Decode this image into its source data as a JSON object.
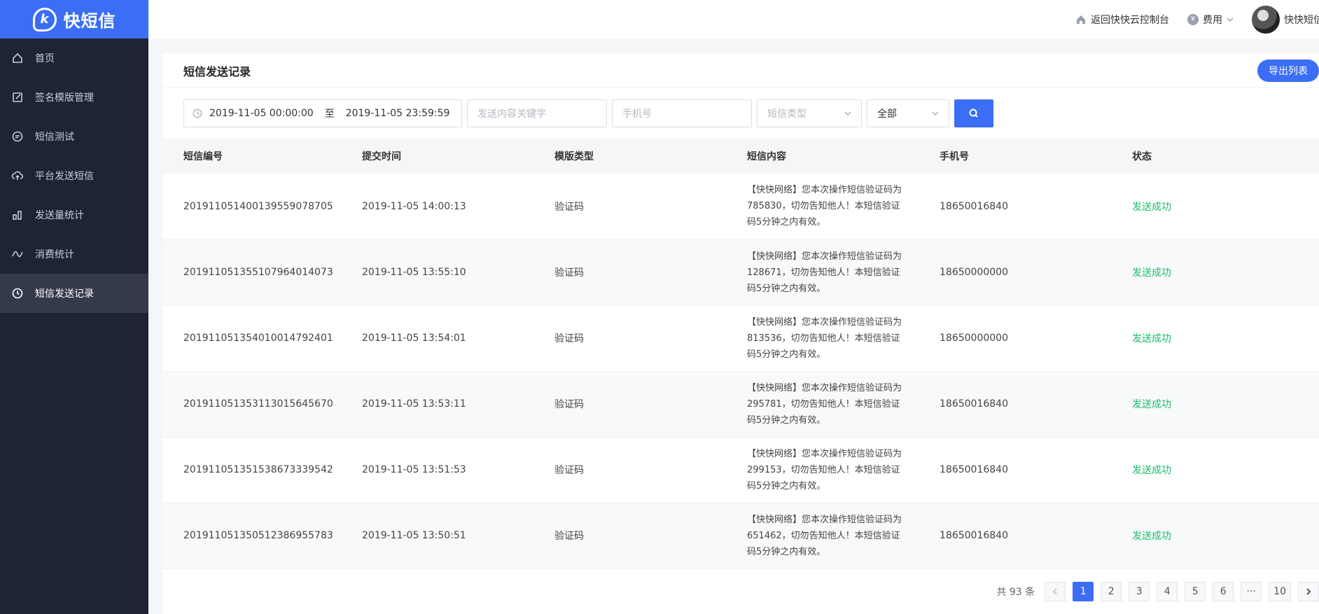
{
  "brand": {
    "logo_glyph": "k",
    "name": "快短信"
  },
  "sidebar": {
    "items": [
      {
        "label": "首页",
        "icon": "home-icon",
        "active": false
      },
      {
        "label": "签名模版管理",
        "icon": "edit-icon",
        "active": false
      },
      {
        "label": "短信测试",
        "icon": "message-icon",
        "active": false
      },
      {
        "label": "平台发送短信",
        "icon": "cloud-upload-icon",
        "active": false
      },
      {
        "label": "发送量统计",
        "icon": "bar-chart-icon",
        "active": false
      },
      {
        "label": "消费统计",
        "icon": "trend-icon",
        "active": false
      },
      {
        "label": "短信发送记录",
        "icon": "clock-icon",
        "active": true
      }
    ]
  },
  "topbar": {
    "back_link": "返回快快云控制台",
    "fee_label": "费用",
    "fee_icon_glyph": "¥",
    "username": "快快短信"
  },
  "page": {
    "title": "短信发送记录",
    "export_label": "导出列表"
  },
  "filters": {
    "date_start": "2019-11-05 00:00:00",
    "date_sep": "至",
    "date_end": "2019-11-05 23:59:59",
    "keyword_placeholder": "发送内容关键字",
    "phone_placeholder": "手机号",
    "type_placeholder": "短信类型",
    "status_value": "全部"
  },
  "table": {
    "columns": [
      "短信编号",
      "提交时间",
      "模版类型",
      "短信内容",
      "手机号",
      "状态"
    ],
    "rows": [
      {
        "id": "20191105140013955907 8705",
        "time": "2019-11-05 14:00:13",
        "type": "验证码",
        "content": "【快快网络】您本次操作短信验证码为785830，切勿告知他人！本短信验证码5分钟之内有效。",
        "phone": "18650016840",
        "status": "发送成功"
      },
      {
        "id": "201911051355107964014073",
        "time": "2019-11-05 13:55:10",
        "type": "验证码",
        "content": "【快快网络】您本次操作短信验证码为128671，切勿告知他人！本短信验证码5分钟之内有效。",
        "phone": "18650000000",
        "status": "发送成功"
      },
      {
        "id": "201911051354010014792401",
        "time": "2019-11-05 13:54:01",
        "type": "验证码",
        "content": "【快快网络】您本次操作短信验证码为813536，切勿告知他人！本短信验证码5分钟之内有效。",
        "phone": "18650000000",
        "status": "发送成功"
      },
      {
        "id": "201911051353113015645670",
        "time": "2019-11-05 13:53:11",
        "type": "验证码",
        "content": "【快快网络】您本次操作短信验证码为295781，切勿告知他人！本短信验证码5分钟之内有效。",
        "phone": "18650016840",
        "status": "发送成功"
      },
      {
        "id": "201911051351538673339542",
        "time": "2019-11-05 13:51:53",
        "type": "验证码",
        "content": "【快快网络】您本次操作短信验证码为299153，切勿告知他人！本短信验证码5分钟之内有效。",
        "phone": "18650016840",
        "status": "发送成功"
      },
      {
        "id": "201911051350512386955783",
        "time": "2019-11-05 13:50:51",
        "type": "验证码",
        "content": "【快快网络】您本次操作短信验证码为651462，切勿告知他人！本短信验证码5分钟之内有效。",
        "phone": "18650016840",
        "status": "发送成功"
      }
    ]
  },
  "pagination": {
    "total_label": "共 93 条",
    "pages": [
      "1",
      "2",
      "3",
      "4",
      "5",
      "6",
      "···",
      "10"
    ],
    "current": "1"
  },
  "colors": {
    "accent": "#3b6ef5",
    "sidebar_bg": "#1e2436",
    "success": "#19be6b"
  }
}
